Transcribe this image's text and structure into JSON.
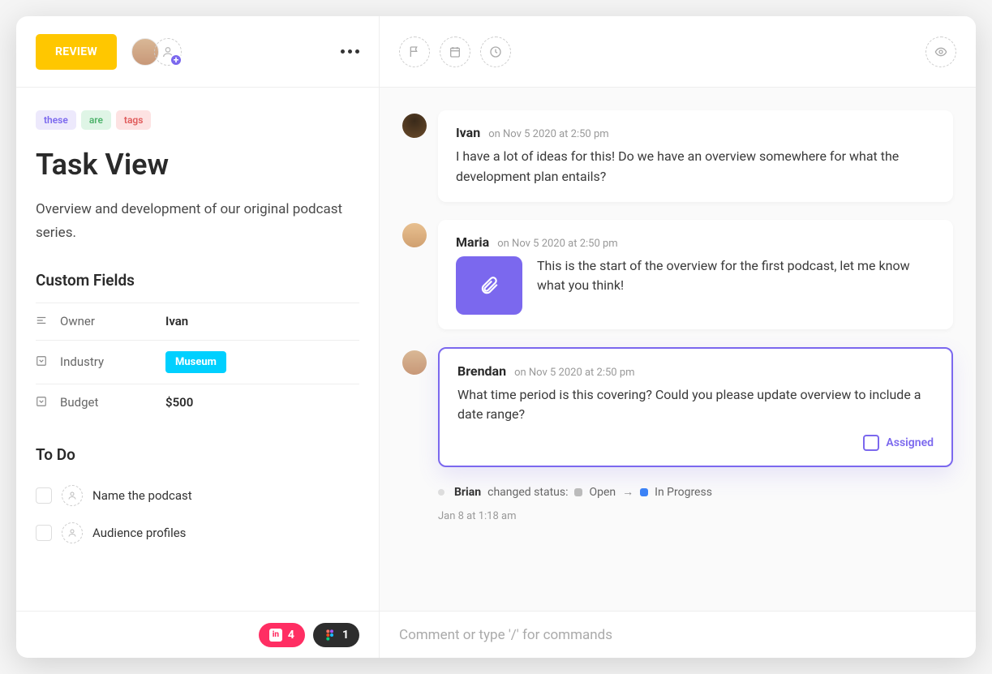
{
  "header": {
    "status": "REVIEW"
  },
  "tags": [
    "these",
    "are",
    "tags"
  ],
  "title": "Task View",
  "description": "Overview and development of our original podcast series.",
  "sections": {
    "custom_fields": "Custom Fields",
    "todo": "To Do"
  },
  "fields": {
    "owner": {
      "label": "Owner",
      "value": "Ivan"
    },
    "industry": {
      "label": "Industry",
      "value": "Museum"
    },
    "budget": {
      "label": "Budget",
      "value": "$500"
    }
  },
  "todos": [
    {
      "text": "Name the podcast"
    },
    {
      "text": "Audience profiles"
    }
  ],
  "comments": [
    {
      "author": "Ivan",
      "meta": "on Nov 5 2020 at 2:50 pm",
      "text": "I have a lot of ideas for this! Do we have an overview somewhere for what the development plan entails?"
    },
    {
      "author": "Maria",
      "meta": "on Nov 5 2020 at 2:50 pm",
      "text": "This is the start of the overview for the first podcast, let me know what you think!"
    },
    {
      "author": "Brendan",
      "meta": "on Nov 5 2020 at 2:50 pm",
      "text": "What time period is this covering? Could you please update overview to include a date range?",
      "assigned_label": "Assigned"
    }
  ],
  "activity": {
    "actor": "Brian",
    "action": "changed status:",
    "from": "Open",
    "to": "In Progress",
    "time": "Jan 8 at 1:18 am"
  },
  "attachments": {
    "invision_count": "4",
    "figma_count": "1"
  },
  "composer": {
    "placeholder": "Comment or type '/' for commands"
  }
}
